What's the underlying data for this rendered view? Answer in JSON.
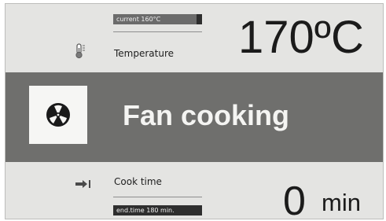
{
  "temperature": {
    "current_label": "current 160°C",
    "current_fraction": 0.94,
    "label": "Temperature",
    "value": "170ºC",
    "icon": "thermometer-icon"
  },
  "mode": {
    "label": "Fan cooking",
    "icon": "fan-icon"
  },
  "cook_time": {
    "label": "Cook time",
    "value": "0",
    "unit": "min",
    "end_time_label": "end.time 180 min.",
    "icon": "arrow-right-bar-icon"
  },
  "colors": {
    "background": "#e4e4e2",
    "band": "#6f6f6d",
    "pill": "#2e2e2e",
    "text": "#1b1b1b"
  }
}
